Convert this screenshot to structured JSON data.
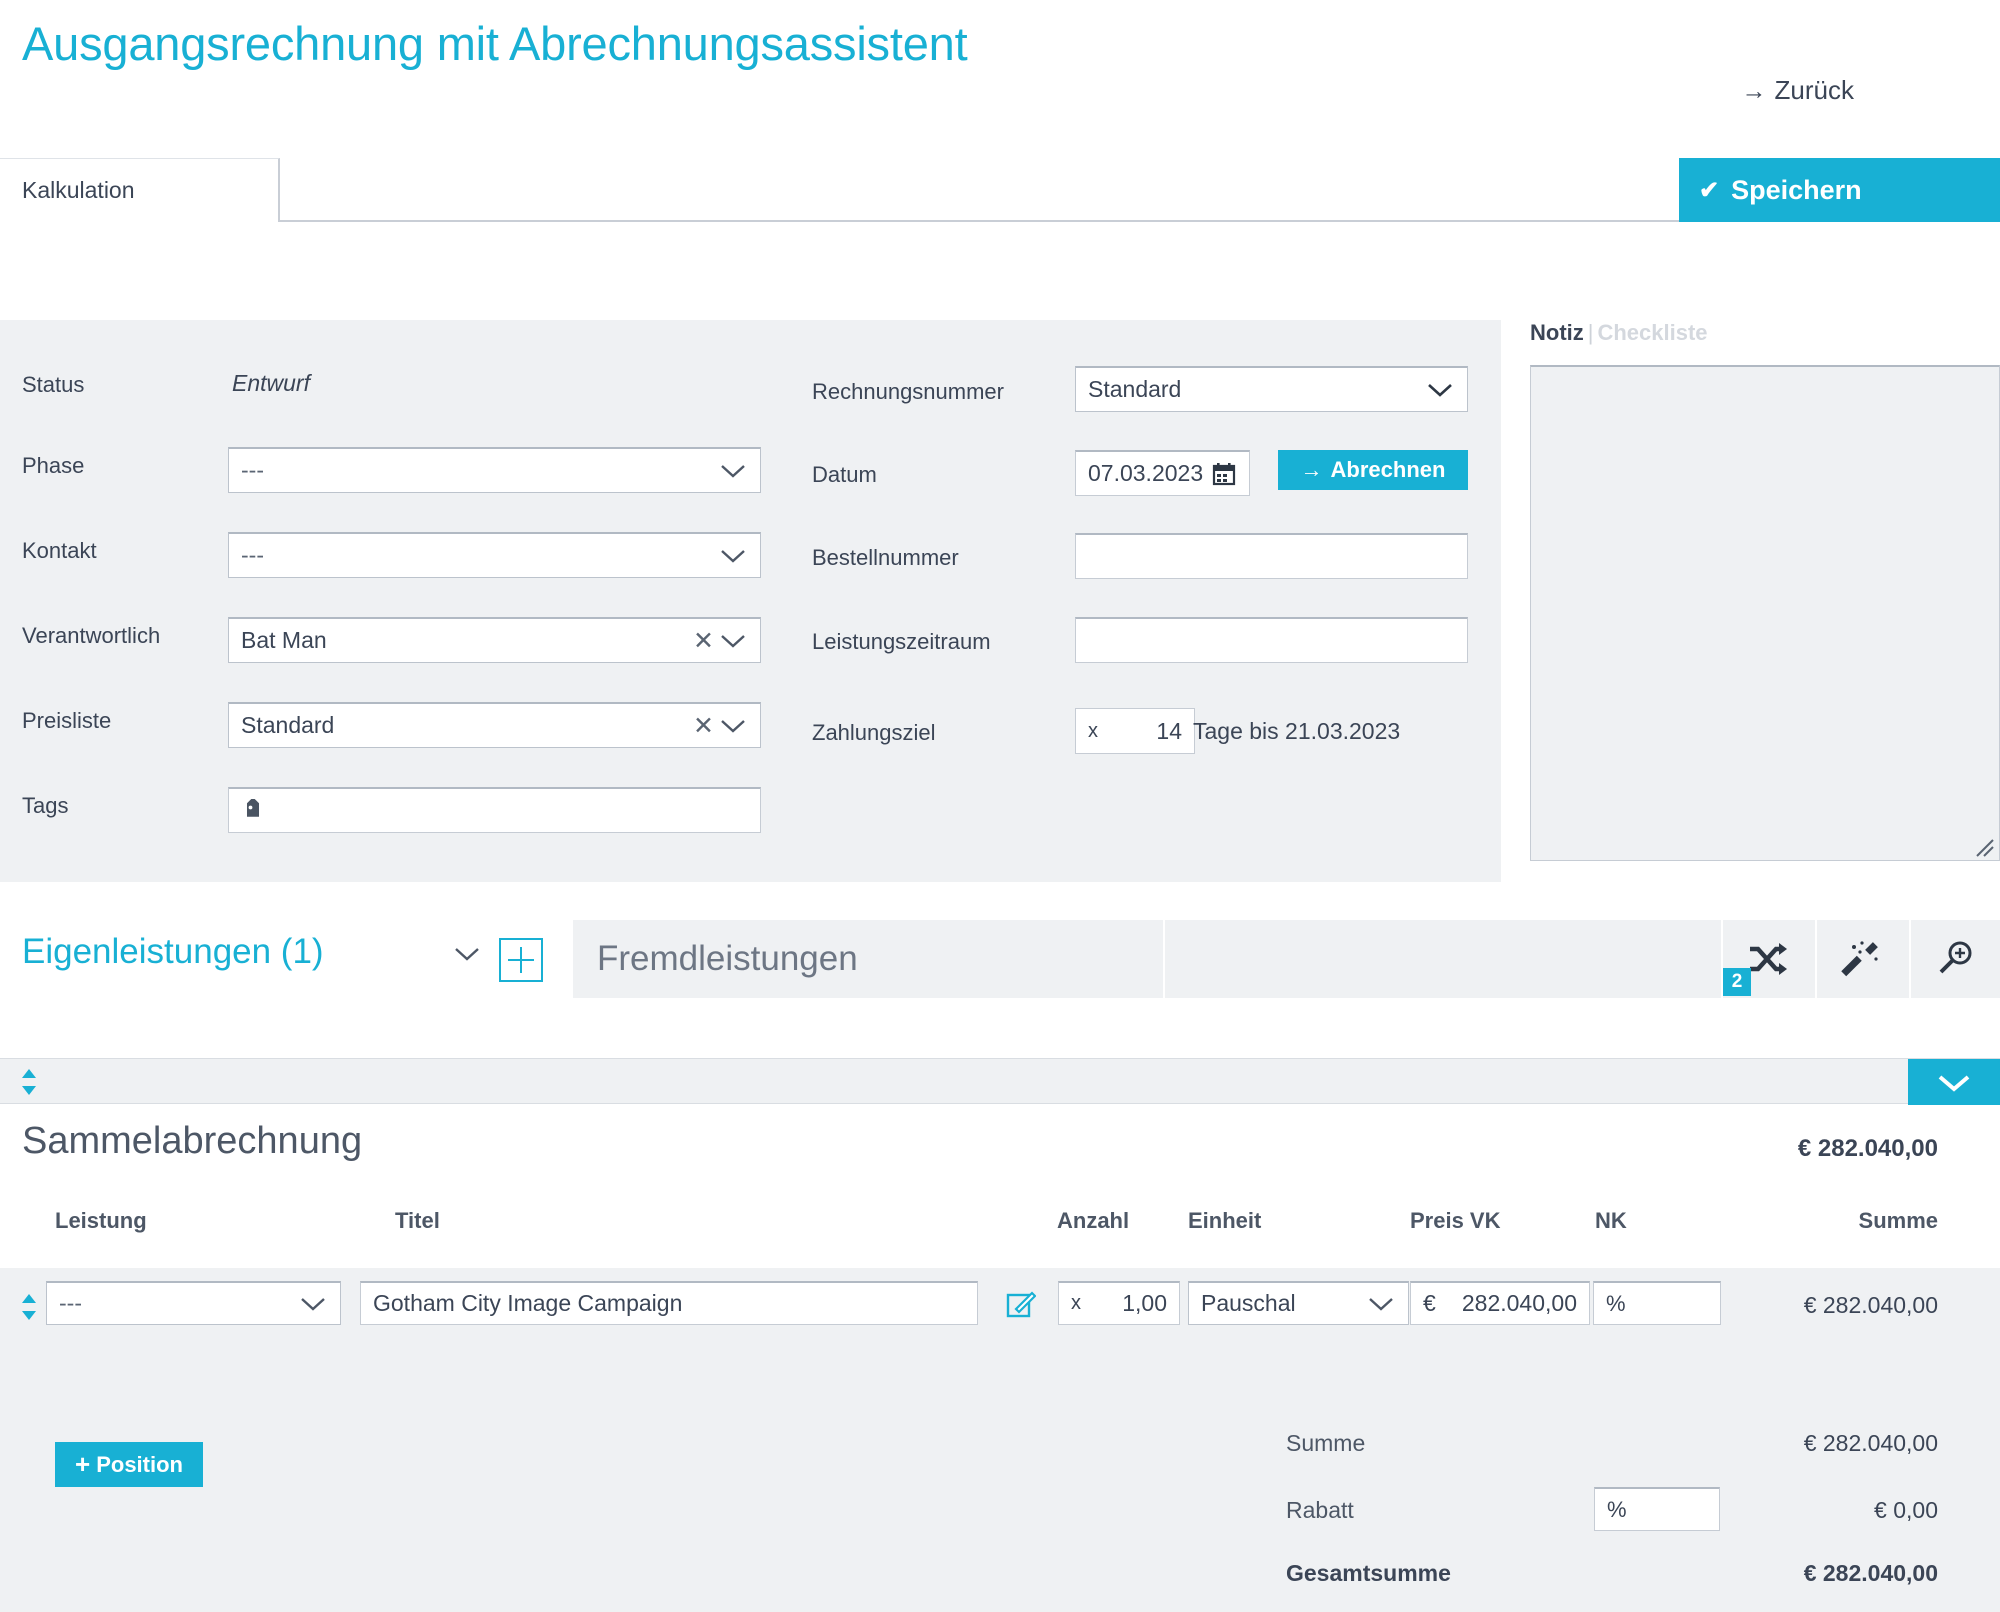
{
  "header": {
    "title": "Ausgangsrechnung mit Abrechnungsassistent",
    "back_label": "Zurück",
    "back_arrow": "→",
    "save_label": "Speichern",
    "save_check": "✔"
  },
  "tabs": {
    "kalkulation": "Kalkulation"
  },
  "form": {
    "left": {
      "status_label": "Status",
      "status_value": "Entwurf",
      "phase_label": "Phase",
      "phase_value": "---",
      "kontakt_label": "Kontakt",
      "kontakt_value": "---",
      "verantwortlich_label": "Verantwortlich",
      "verantwortlich_value": "Bat Man",
      "preisliste_label": "Preisliste",
      "preisliste_value": "Standard",
      "tags_label": "Tags",
      "tags_value": ""
    },
    "right": {
      "rechnungsnummer_label": "Rechnungsnummer",
      "rechnungsnummer_value": "Standard",
      "datum_label": "Datum",
      "datum_value": "07.03.2023",
      "abrechnen_label": "Abrechnen",
      "abrechnen_arrow": "→",
      "bestellnummer_label": "Bestellnummer",
      "bestellnummer_value": "",
      "leistungszeitraum_label": "Leistungszeitraum",
      "leistungszeitraum_value": "",
      "zahlungsziel_label": "Zahlungsziel",
      "zahlungsziel_multiplier": "x",
      "zahlungsziel_days": "14",
      "zahlungsziel_note": "Tage bis 21.03.2023"
    }
  },
  "notiz": {
    "tab_notiz": "Notiz",
    "separator": "|",
    "tab_checkliste": "Checkliste",
    "content": ""
  },
  "leistungen": {
    "eigen_label": "Eigenleistungen (1)",
    "fremd_label": "Fremdleistungen",
    "shuffle_badge": "2"
  },
  "group": {
    "title": "Sammelabrechnung",
    "total": "€ 282.040,00"
  },
  "table": {
    "columns": {
      "leistung": "Leistung",
      "titel": "Titel",
      "anzahl": "Anzahl",
      "einheit": "Einheit",
      "preis_vk": "Preis VK",
      "nk": "NK",
      "summe": "Summe"
    },
    "rows": [
      {
        "leistung": "---",
        "titel": "Gotham City Image Campaign",
        "anzahl_prefix": "x",
        "anzahl": "1,00",
        "einheit": "Pauschal",
        "preis_currency": "€",
        "preis_vk": "282.040,00",
        "nk": "%",
        "summe": "€ 282.040,00"
      }
    ]
  },
  "footer": {
    "add_position_label": "Position",
    "add_position_plus": "+",
    "summe_label": "Summe",
    "summe_value": "€ 282.040,00",
    "rabatt_label": "Rabatt",
    "rabatt_percent": "%",
    "rabatt_value": "€ 0,00",
    "gesamtsumme_label": "Gesamtsumme",
    "gesamtsumme_value": "€ 282.040,00"
  },
  "colors": {
    "accent": "#18b0d4",
    "panel": "#eff1f3",
    "text": "#3b4556"
  }
}
